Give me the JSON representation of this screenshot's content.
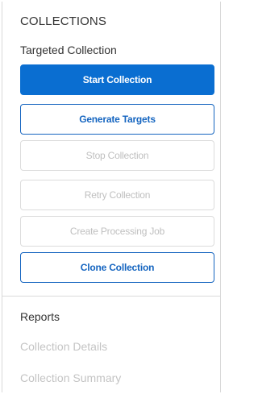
{
  "collections": {
    "section_title": "COLLECTIONS",
    "group_title": "Targeted Collection",
    "buttons": {
      "start": "Start Collection",
      "generate": "Generate Targets",
      "stop": "Stop Collection",
      "retry": "Retry Collection",
      "create_job": "Create Processing Job",
      "clone": "Clone Collection"
    }
  },
  "reports": {
    "title": "Reports",
    "links": {
      "details": "Collection Details",
      "summary": "Collection Summary"
    }
  },
  "colors": {
    "primary": "#0a6ed1",
    "outline": "#1565c0",
    "disabled_text": "#bfbfbf",
    "heading_text": "#333333"
  }
}
